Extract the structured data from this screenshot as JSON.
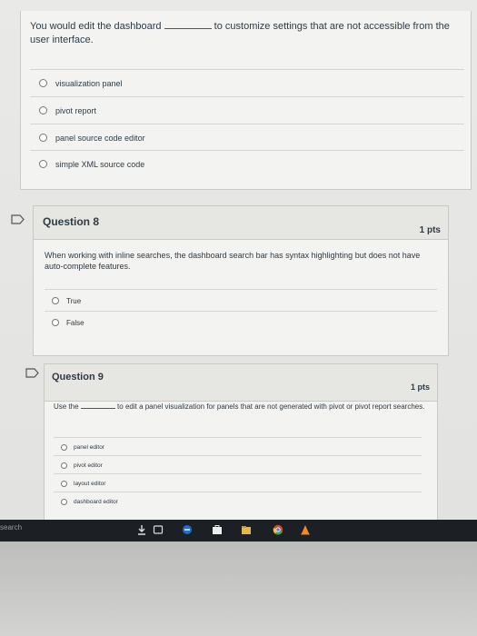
{
  "q7": {
    "text_before": "You would edit the dashboard",
    "text_after": "to customize settings that are not accessible from the user interface.",
    "options": [
      "visualization panel",
      "pivot report",
      "panel source code editor",
      "simple XML source code"
    ]
  },
  "q8": {
    "title": "Question 8",
    "points": "1 pts",
    "text": "When working with inline searches, the dashboard search bar has syntax highlighting but does not have auto-complete features.",
    "options": [
      "True",
      "False"
    ]
  },
  "q9": {
    "title": "Question 9",
    "points": "1 pts",
    "text_before": "Use the",
    "text_after": "to edit a panel visualization for panels that are not generated with pivot or pivot report searches.",
    "options": [
      "panel editor",
      "pivot editor",
      "layout editor",
      "dashboard editor"
    ]
  },
  "taskbar": {
    "search_label": "search",
    "icons": [
      "download-icon",
      "task-view-icon",
      "edge-icon",
      "store-icon",
      "file-explorer-icon",
      "chrome-icon",
      "vlc-icon"
    ]
  },
  "colors": {
    "heading": "#2d3b45",
    "card_bg": "#f3f3f1",
    "taskbar_bg": "#1c1f24"
  }
}
